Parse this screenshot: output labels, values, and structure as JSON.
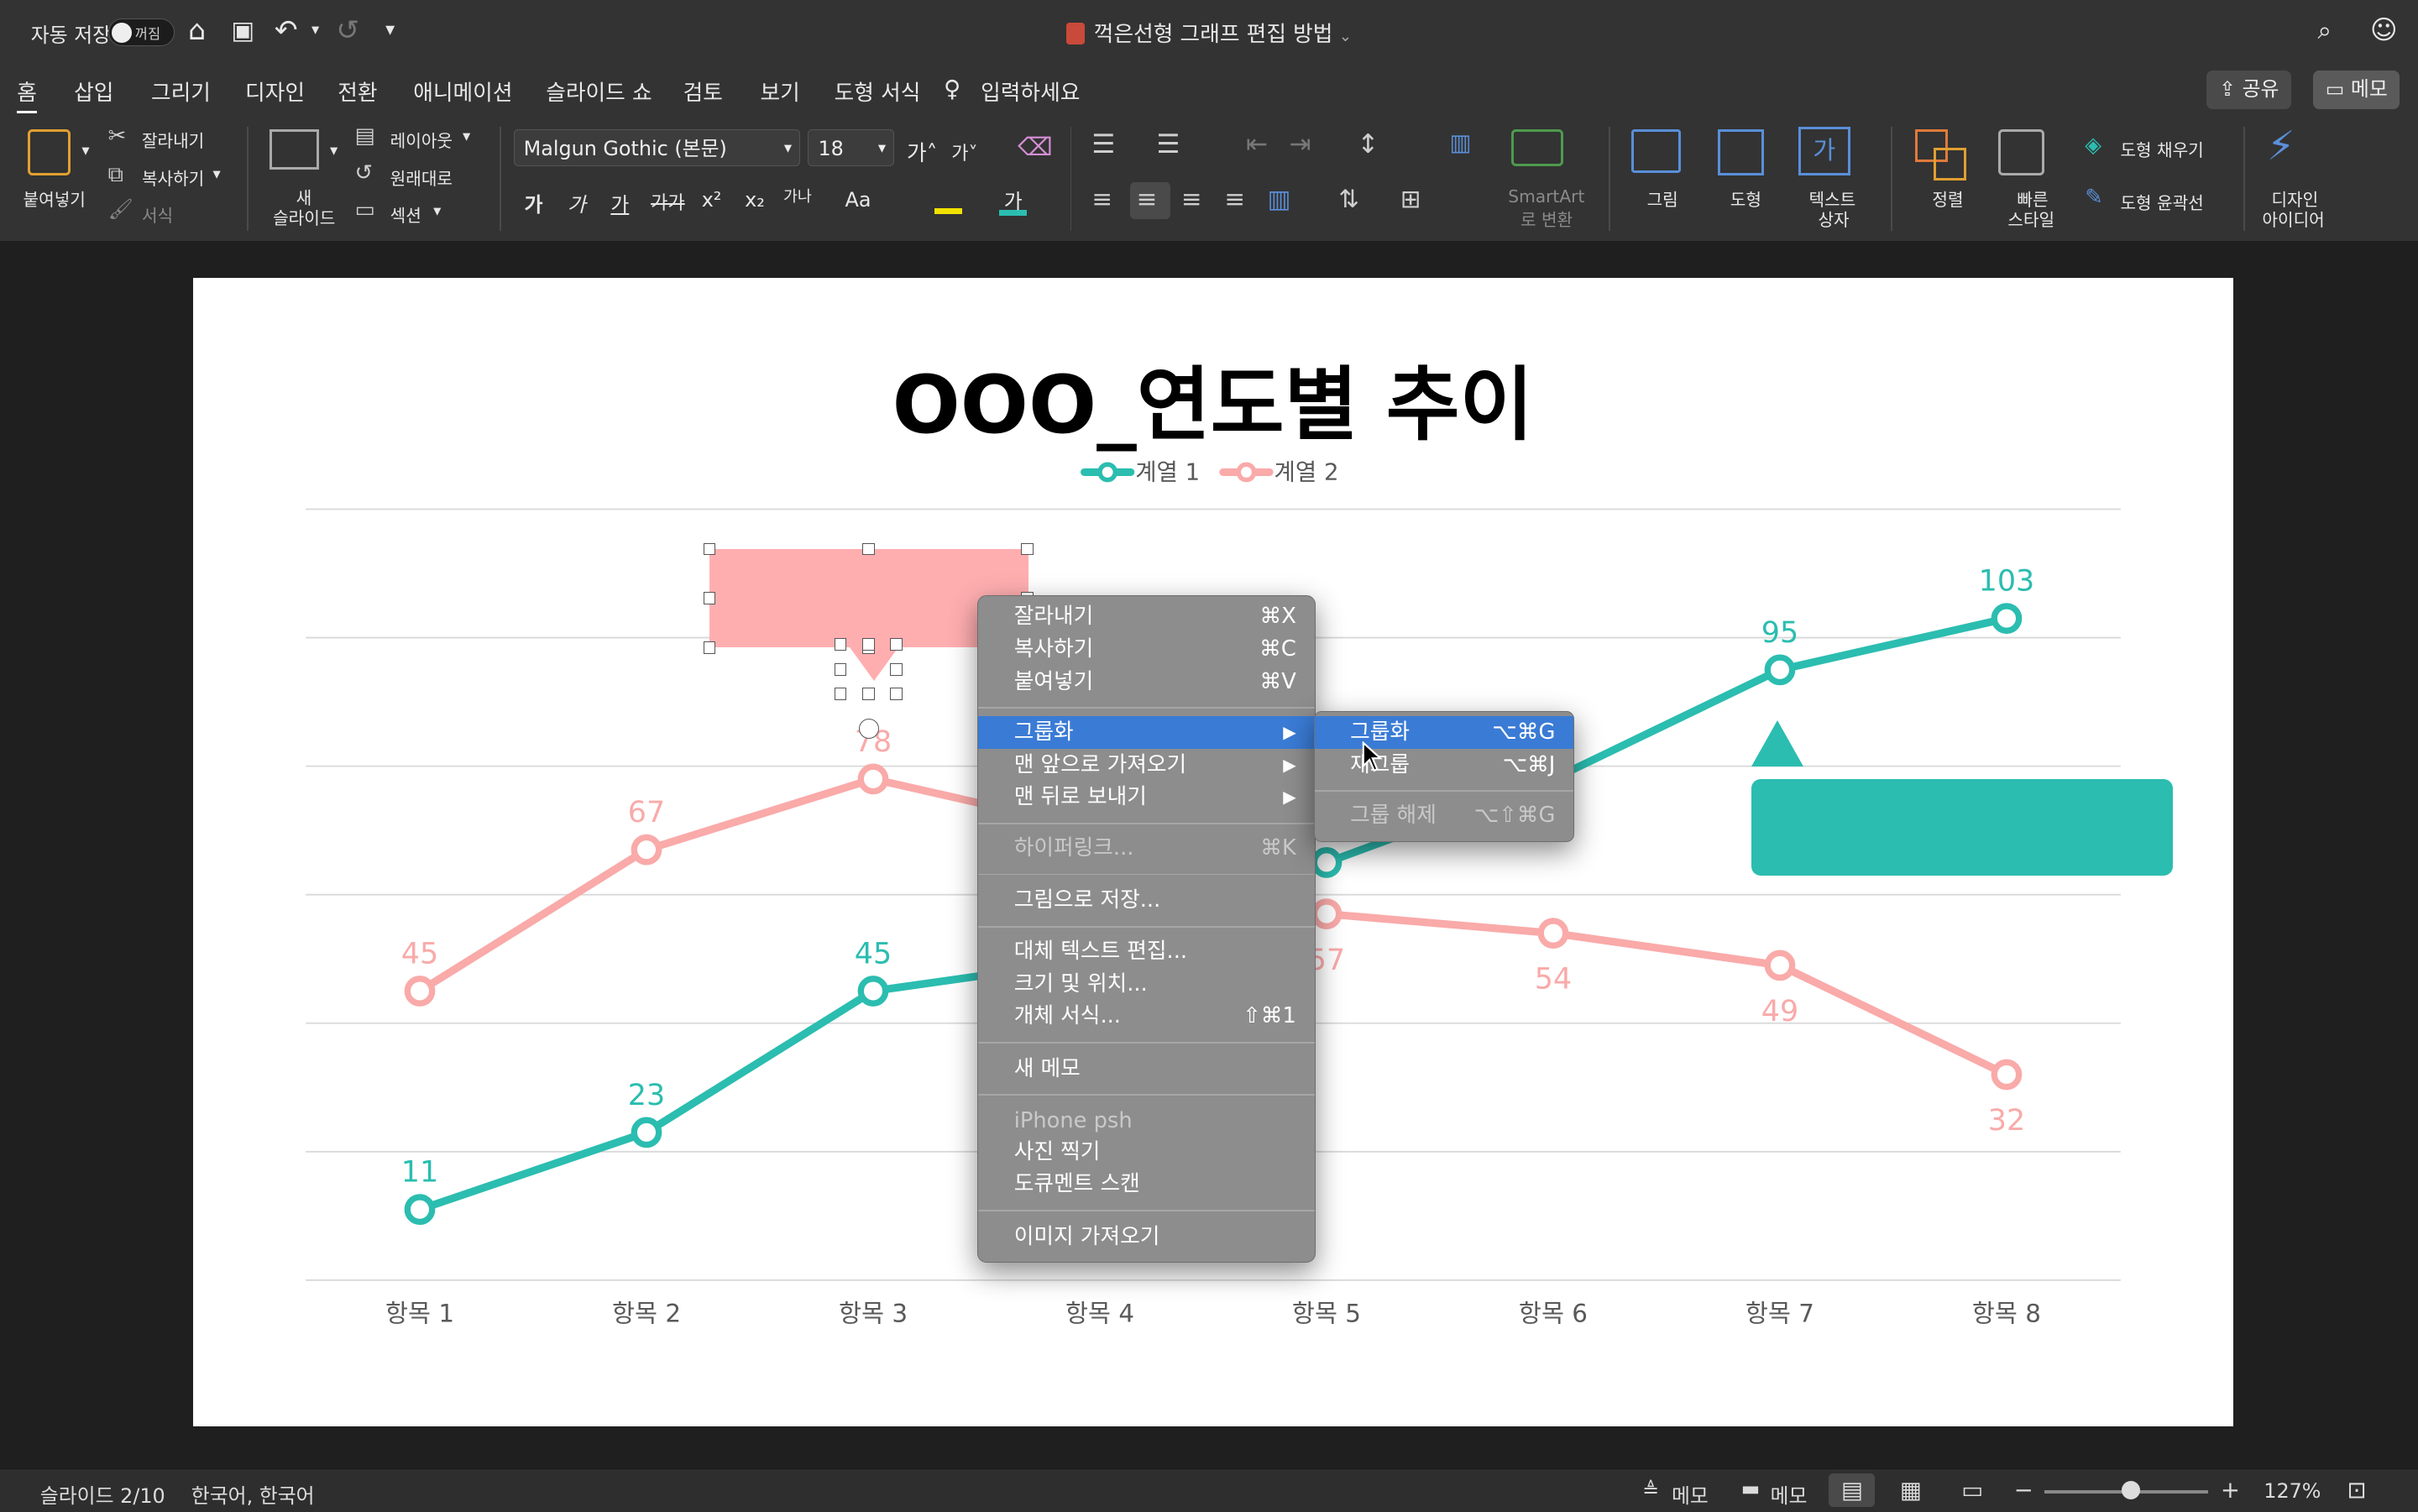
{
  "titlebar": {
    "autosave_label": "자동 저장",
    "autosave_state": "꺼짐",
    "doc_title": "꺽은선형 그래프 편집 방법"
  },
  "menubar": {
    "tabs": [
      "홈",
      "삽입",
      "그리기",
      "디자인",
      "전환",
      "애니메이션",
      "슬라이드 쇼",
      "검토",
      "보기",
      "도형 서식"
    ],
    "tell_me": "입력하세요",
    "share": "공유",
    "comments": "메모"
  },
  "ribbon": {
    "paste": "붙여넣기",
    "cut": "잘라내기",
    "copy": "복사하기",
    "format": "서식",
    "new_slide_1": "새",
    "new_slide_2": "슬라이드",
    "layout": "레이아웃",
    "reset": "원래대로",
    "section": "섹션",
    "font_name": "Malgun Gothic (본문)",
    "font_size": "18",
    "smartart_1": "SmartArt",
    "smartart_2": "로 변환",
    "picture": "그림",
    "shapes": "도형",
    "textbox_1": "텍스트",
    "textbox_2": "상자",
    "arrange": "정렬",
    "quick_styles_1": "빠른",
    "quick_styles_2": "스타일",
    "shape_fill": "도형 채우기",
    "shape_outline": "도형 윤곽선",
    "design_ideas_1": "디자인",
    "design_ideas_2": "아이디어",
    "font_btns": [
      "가",
      "가",
      "가",
      "가가",
      "x²",
      "x₂",
      "가나",
      "Aa"
    ]
  },
  "slide": {
    "title": "OOO_연도별 추이"
  },
  "chart_data": {
    "type": "line",
    "categories": [
      "항목 1",
      "항목 2",
      "항목 3",
      "항목 4",
      "항목 5",
      "항목 6",
      "항목 7",
      "항목 8"
    ],
    "series": [
      {
        "name": "계열 1",
        "color": "#2bbdb0",
        "values": [
          11,
          23,
          45,
          50,
          65,
          78,
          95,
          103
        ],
        "labels_visible": [
          true,
          true,
          true,
          false,
          false,
          false,
          true,
          true
        ]
      },
      {
        "name": "계열 2",
        "color": "#f9aaa9",
        "values": [
          45,
          67,
          78,
          70,
          57,
          54,
          49,
          32
        ],
        "labels_visible": [
          true,
          true,
          true,
          false,
          true,
          true,
          true,
          true
        ]
      }
    ],
    "ylim": [
      0,
      120
    ],
    "gridlines": true,
    "legend": "top"
  },
  "context_menu": {
    "items": [
      {
        "label": "잘라내기",
        "shortcut": "⌘X"
      },
      {
        "label": "복사하기",
        "shortcut": "⌘C"
      },
      {
        "label": "붙여넣기",
        "shortcut": "⌘V"
      },
      {
        "label": "그룹화",
        "shortcut": "▶"
      },
      {
        "label": "맨 앞으로 가져오기",
        "shortcut": "▶"
      },
      {
        "label": "맨 뒤로 보내기",
        "shortcut": "▶"
      },
      {
        "label": "하이퍼링크...",
        "shortcut": "⌘K"
      },
      {
        "label": "그림으로 저장...",
        "shortcut": ""
      },
      {
        "label": "대체 텍스트 편집...",
        "shortcut": ""
      },
      {
        "label": "크기 및 위치...",
        "shortcut": ""
      },
      {
        "label": "개체 서식...",
        "shortcut": "⇧⌘1"
      },
      {
        "label": "새 메모",
        "shortcut": ""
      },
      {
        "label": "iPhone psh",
        "shortcut": ""
      },
      {
        "label": "사진 찍기",
        "shortcut": ""
      },
      {
        "label": "도큐멘트 스캔",
        "shortcut": ""
      },
      {
        "label": "이미지 가져오기",
        "shortcut": ""
      }
    ]
  },
  "submenu": {
    "items": [
      {
        "label": "그룹화",
        "shortcut": "⌥⌘G"
      },
      {
        "label": "재그룹",
        "shortcut": "⌥⌘J"
      },
      {
        "label": "그룹 해제",
        "shortcut": "⌥⇧⌘G"
      }
    ]
  },
  "statusbar": {
    "slide": "슬라이드 2/10",
    "language": "한국어, 한국어",
    "notes": "메모",
    "comments": "메모",
    "zoom": "127%"
  },
  "colors": {
    "teal": "#2bbdb0",
    "pink": "#f9aaa9",
    "highlight": "#3a7bd5"
  }
}
